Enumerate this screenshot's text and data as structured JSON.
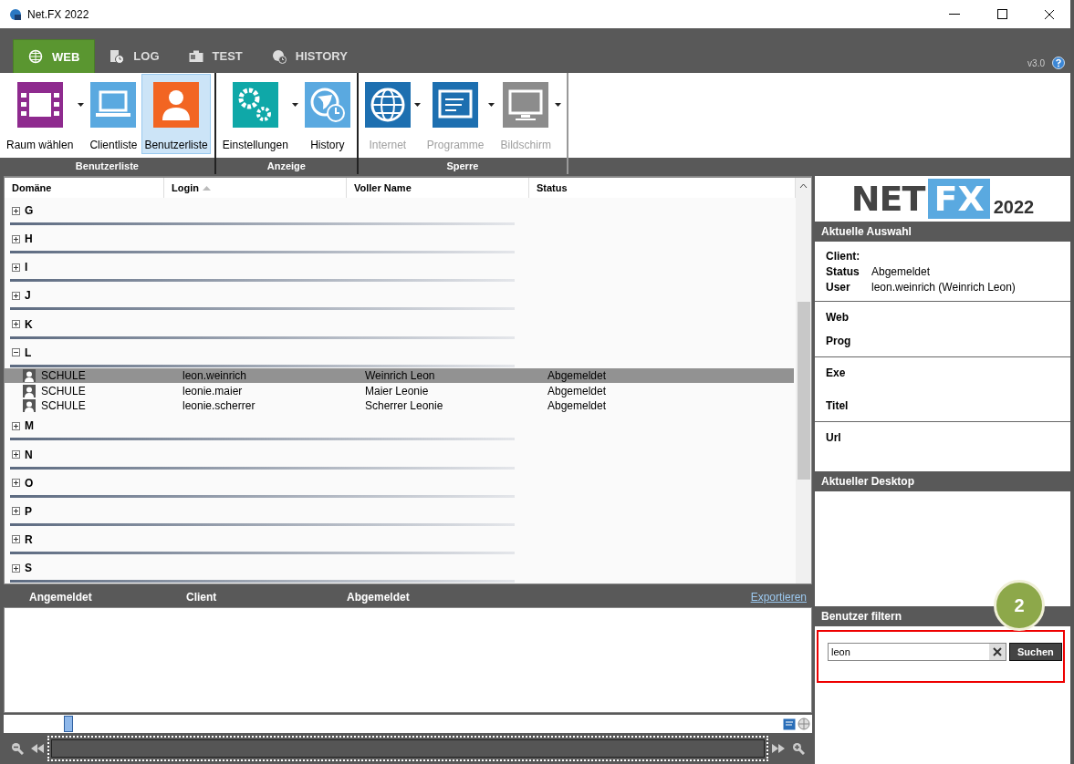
{
  "window": {
    "title": "Net.FX 2022"
  },
  "tabs": [
    {
      "label": "WEB",
      "kind": "globe",
      "selected": true
    },
    {
      "label": "LOG",
      "kind": "log",
      "selected": false
    },
    {
      "label": "TEST",
      "kind": "card",
      "selected": false
    },
    {
      "label": "HISTORY",
      "kind": "history",
      "selected": false
    }
  ],
  "version": "v3.0",
  "ribbon": [
    {
      "label": "Benutzerliste",
      "buttons": [
        {
          "label": "Raum wählen",
          "kind": "film",
          "dropdown": true,
          "selected": false,
          "disabled": false
        },
        {
          "label": "Clientliste",
          "kind": "laptop",
          "dropdown": false,
          "selected": false,
          "disabled": false
        },
        {
          "label": "Benutzerliste",
          "kind": "user",
          "dropdown": false,
          "selected": true,
          "disabled": false
        }
      ]
    },
    {
      "label": "Anzeige",
      "buttons": [
        {
          "label": "Einstellungen",
          "kind": "gears",
          "dropdown": true,
          "selected": false,
          "disabled": false
        },
        {
          "label": "History",
          "kind": "globe-clock",
          "dropdown": false,
          "selected": false,
          "disabled": false
        }
      ]
    },
    {
      "label": "Sperre",
      "buttons": [
        {
          "label": "Internet",
          "kind": "globe",
          "dropdown": true,
          "selected": false,
          "disabled": true
        },
        {
          "label": "Programme",
          "kind": "window",
          "dropdown": true,
          "selected": false,
          "disabled": true
        },
        {
          "label": "Bildschirm",
          "kind": "monitor",
          "dropdown": true,
          "selected": false,
          "disabled": true
        }
      ]
    }
  ],
  "table": {
    "columns": [
      {
        "label": "Domäne",
        "sorted": false
      },
      {
        "label": "Login",
        "sorted": true
      },
      {
        "label": "Voller Name",
        "sorted": false
      },
      {
        "label": "Status",
        "sorted": false
      }
    ],
    "groups": [
      {
        "label": "G",
        "expanded": false
      },
      {
        "label": "H",
        "expanded": false
      },
      {
        "label": "I",
        "expanded": false
      },
      {
        "label": "J",
        "expanded": false
      },
      {
        "label": "K",
        "expanded": false
      },
      {
        "label": "L",
        "expanded": true,
        "rows": [
          {
            "domain": "SCHULE",
            "login": "leon.weinrich",
            "name": "Weinrich Leon",
            "status": "Abgemeldet",
            "selected": true
          },
          {
            "domain": "SCHULE",
            "login": "leonie.maier",
            "name": "Maier Leonie",
            "status": "Abgemeldet",
            "selected": false
          },
          {
            "domain": "SCHULE",
            "login": "leonie.scherrer",
            "name": "Scherrer Leonie",
            "status": "Abgemeldet",
            "selected": false
          }
        ]
      },
      {
        "label": "M",
        "expanded": false
      },
      {
        "label": "N",
        "expanded": false
      },
      {
        "label": "O",
        "expanded": false
      },
      {
        "label": "P",
        "expanded": false
      },
      {
        "label": "R",
        "expanded": false
      },
      {
        "label": "S",
        "expanded": false
      }
    ]
  },
  "history": {
    "columns": [
      "Angemeldet",
      "Client",
      "Abgemeldet"
    ],
    "export_link": "Exportieren"
  },
  "side": {
    "logo": {
      "left": "NET",
      "box": "FX",
      "year": "2022"
    },
    "selection_title": "Aktuelle Auswahl",
    "fields": [
      {
        "label": "Client:"
      },
      {
        "label": "Status",
        "value": "Abgemeldet"
      },
      {
        "label": "User",
        "value": "leon.weinrich (Weinrich Leon)"
      }
    ],
    "sections": [
      [
        "Web",
        "Prog"
      ],
      [
        "Exe",
        "Titel"
      ],
      [
        "Url"
      ]
    ],
    "desktop_title": "Aktueller Desktop",
    "filter_title": "Benutzer filtern",
    "filter": {
      "value": "leon",
      "button": "Suchen"
    },
    "callout": "2"
  }
}
